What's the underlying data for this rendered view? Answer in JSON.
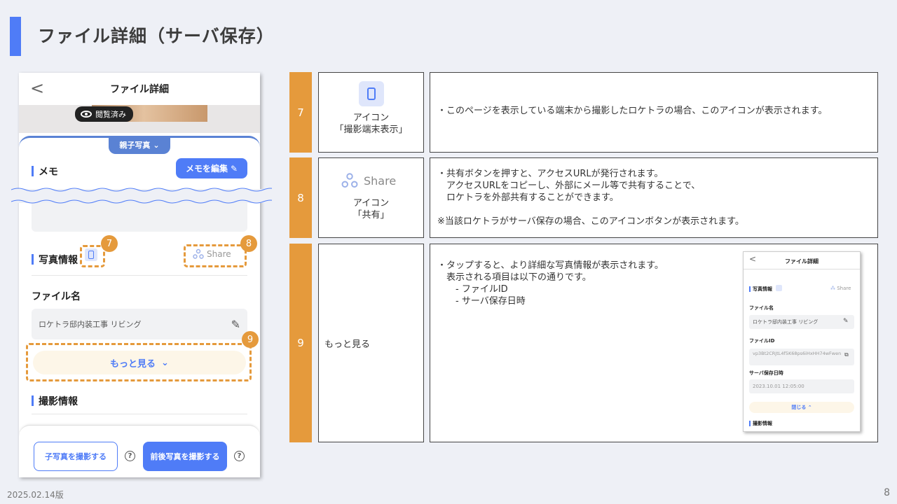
{
  "page": {
    "title": "ファイル詳細（サーバ保存）",
    "date": "2025.02.14版",
    "number": "8"
  },
  "phone": {
    "header_title": "ファイル詳細",
    "back": "<",
    "viewed_badge": "閲覧済み",
    "parent_tab": "親子写真",
    "memo_label": "メモ",
    "memo_edit_button": "メモを編集",
    "photo_info_label": "写真情報",
    "share_label": "Share",
    "filename_label": "ファイル名",
    "filename_value": "ロケトラ邸内装工事 リビング",
    "more_button": "もっと見る",
    "shooting_info_label": "撮影情報",
    "child_photo_button": "子写真を撮影する",
    "front_back_button": "前後写真を撮影する",
    "help": "?"
  },
  "callouts": [
    "7",
    "8",
    "9"
  ],
  "rows": [
    {
      "number": "7",
      "name_line1": "アイコン",
      "name_line2": "「撮影端末表示」",
      "description": "・このページを表示している端末から撮影したロケトラの場合、このアイコンが表示されます。"
    },
    {
      "number": "8",
      "share_text": "Share",
      "name_line1": "アイコン",
      "name_line2": "「共有」",
      "description": "・共有ボタンを押すと、アクセスURLが発行されます。\n　アクセスURLをコピーし、外部にメール等で共有することで、\n　ロケトラを外部共有することができます。\n\n※当該ロケトラがサーバ保存の場合、このアイコンボタンが表示されます。"
    },
    {
      "number": "9",
      "name": "もっと見る",
      "description": "・タップすると、より詳細な写真情報が表示されます。\n　表示される項目は以下の通りです。\n　　- ファイルID\n　　- サーバ保存日時"
    }
  ],
  "mini": {
    "title": "ファイル詳細",
    "back": "<",
    "photo_info": "写真情報",
    "share": "Share",
    "filename_label": "ファイル名",
    "filename_value": "ロケトラ邸内装工事 リビング",
    "fileid_label": "ファイルID",
    "fileid_value": "vp3Bt2CRJtL4f5K68ps6iHxHH74wFwen",
    "saved_label": "サーバ保存日時",
    "saved_value": "2023.10.01 12:05:00",
    "close": "閉じる",
    "shooting_info": "撮影情報"
  }
}
